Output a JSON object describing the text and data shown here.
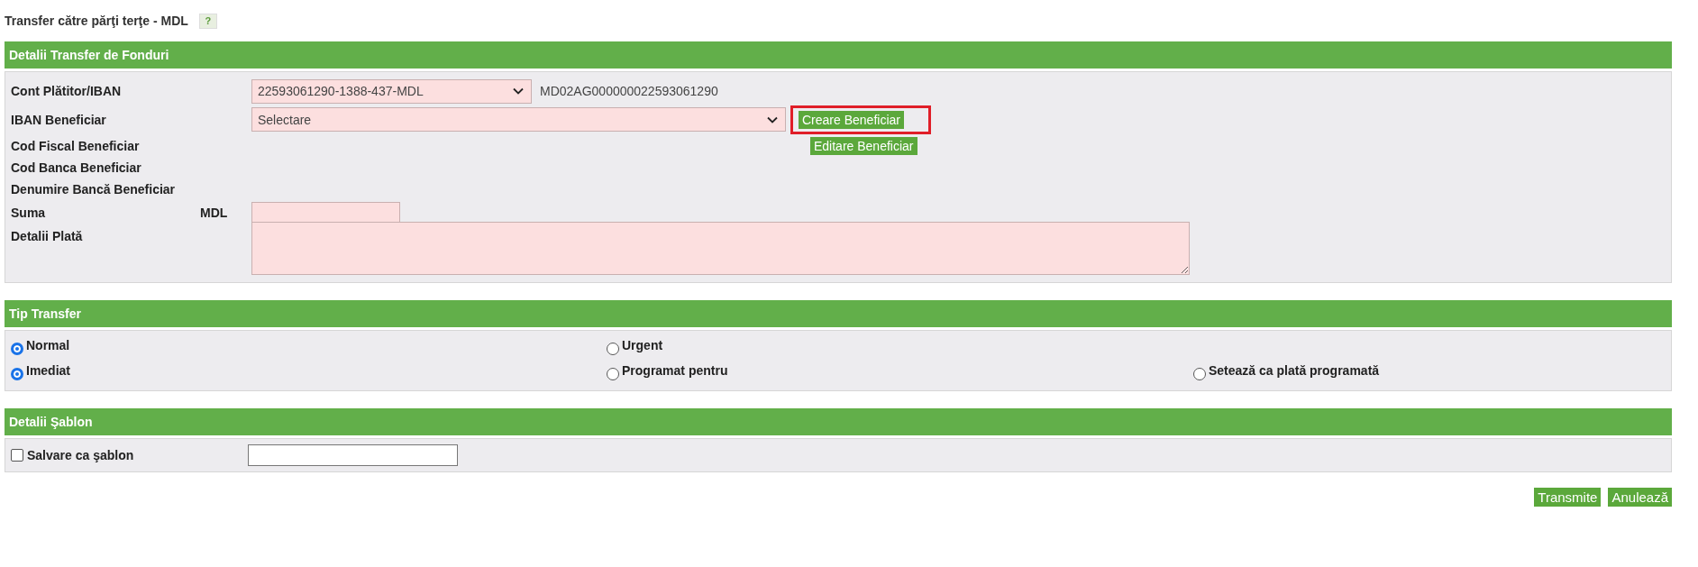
{
  "page_title": "Transfer către părţi terţe - MDL",
  "help_button": "?",
  "funds_section": {
    "header": "Detalii Transfer de Fonduri",
    "payer_account": {
      "label": "Cont Plătitor/IBAN",
      "value": "22593061290-1388-437-MDL",
      "iban": "MD02AG000000022593061290"
    },
    "beneficiary_iban": {
      "label": "IBAN Beneficiar",
      "value": "Selectare"
    },
    "create_button": {
      "label": "Creare Beneficiar",
      "highlighted": true
    },
    "edit_button": {
      "label": "Editare Beneficiar"
    },
    "info_labels": [
      "Cod Fiscal Beneficiar",
      "Cod Banca Beneficiar",
      "Denumire Bancă Beneficiar"
    ],
    "amount": {
      "label": "Suma",
      "currency": "MDL"
    },
    "payment_details": {
      "label": "Detalii Plată"
    }
  },
  "transfer_type": {
    "header": "Tip Transfer",
    "rows": [
      [
        {
          "label": "Normal",
          "selected": true
        },
        {
          "label": "Urgent",
          "selected": false
        }
      ],
      [
        {
          "label": "Imediat",
          "selected": true
        },
        {
          "label": "Programat pentru",
          "selected": false
        },
        {
          "label": "Setează ca plată programată",
          "selected": false
        }
      ]
    ]
  },
  "template_section": {
    "header": "Detalii Şablon",
    "save_as_template": {
      "label": "Salvare ca şablon",
      "checked": false
    }
  },
  "buttons": [
    "Transmite",
    "Anulează"
  ]
}
